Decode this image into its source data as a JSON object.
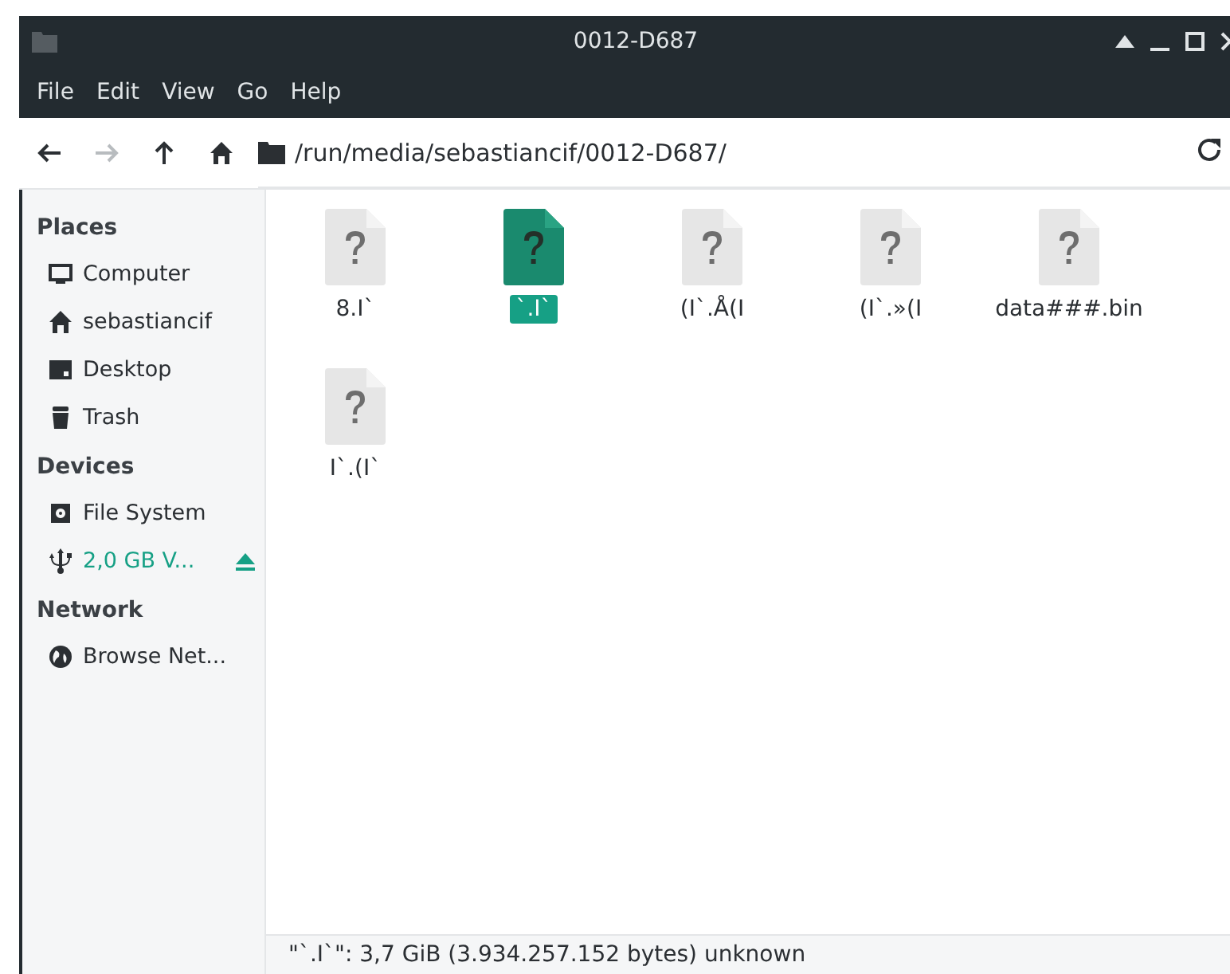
{
  "window": {
    "title": "0012-D687"
  },
  "menu": [
    "File",
    "Edit",
    "View",
    "Go",
    "Help"
  ],
  "toolbar": {
    "back": {
      "disabled": false
    },
    "forward": {
      "disabled": true
    },
    "path": "/run/media/sebastiancif/0012-D687/"
  },
  "sidebar": {
    "sections": [
      {
        "title": "Places",
        "items": [
          {
            "kind": "computer",
            "label": "Computer",
            "selected": false
          },
          {
            "kind": "home",
            "label": "sebastiancif",
            "selected": false
          },
          {
            "kind": "desktop",
            "label": "Desktop",
            "selected": false
          },
          {
            "kind": "trash",
            "label": "Trash",
            "selected": false
          }
        ]
      },
      {
        "title": "Devices",
        "items": [
          {
            "kind": "disk",
            "label": "File System",
            "selected": false
          },
          {
            "kind": "usb",
            "label": "2,0 GB V...",
            "selected": true,
            "ejectable": true
          }
        ]
      },
      {
        "title": "Network",
        "items": [
          {
            "kind": "network",
            "label": "Browse Net...",
            "selected": false
          }
        ]
      }
    ]
  },
  "files": [
    {
      "name": "8.I`",
      "selected": false
    },
    {
      "name": "`.I`",
      "selected": true
    },
    {
      "name": "(I`.Å(I",
      "selected": false
    },
    {
      "name": "(I`.»(I",
      "selected": false
    },
    {
      "name": "data###.bin",
      "selected": false
    },
    {
      "name": "I`.(I`",
      "selected": false
    }
  ],
  "status_bar": "\"`.I`\": 3,7 GiB (3.934.257.152 bytes) unknown"
}
